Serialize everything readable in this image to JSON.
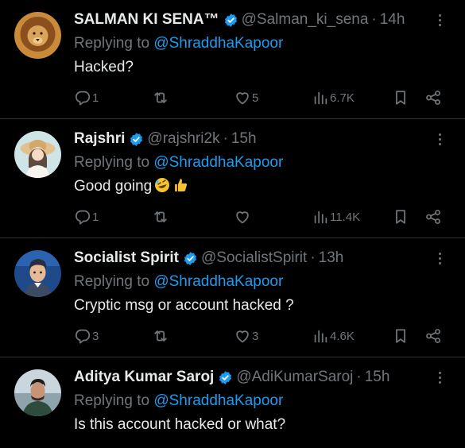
{
  "replies": [
    {
      "name": "SALMAN KI SENA™",
      "handle": "@Salman_ki_sena",
      "dot": "·",
      "time": "14h",
      "replying_prefix": "Replying to ",
      "replying_to": "@ShraddhaKapoor",
      "text": "Hacked?",
      "reply_count": "1",
      "retweet_count": "",
      "like_count": "5",
      "views": "6.7K",
      "avatar_icon": "lion-avatar-icon",
      "emojis": []
    },
    {
      "name": "Rajshri",
      "handle": "@rajshri2k",
      "dot": "·",
      "time": "15h",
      "replying_prefix": "Replying to ",
      "replying_to": "@ShraddhaKapoor",
      "text": "Good going",
      "reply_count": "1",
      "retweet_count": "",
      "like_count": "",
      "views": "11.4K",
      "avatar_icon": "girl-avatar-icon",
      "emojis": [
        "rolling-laughing-emoji",
        "thumbs-up-emoji"
      ]
    },
    {
      "name": "Socialist Spirit",
      "handle": "@SocialistSpirit",
      "dot": "·",
      "time": "13h",
      "replying_prefix": "Replying to ",
      "replying_to": "@ShraddhaKapoor",
      "text": "Cryptic msg or account hacked ?",
      "reply_count": "3",
      "retweet_count": "",
      "like_count": "3",
      "views": "4.6K",
      "avatar_icon": "cartoon-man-avatar-icon",
      "emojis": []
    },
    {
      "name": "Aditya Kumar Saroj",
      "handle": "@AdiKumarSaroj",
      "dot": "·",
      "time": "15h",
      "replying_prefix": "Replying to ",
      "replying_to": "@ShraddhaKapoor",
      "text": "Is this account hacked or what?",
      "avatar_icon": "man-photo-avatar-icon",
      "emojis": []
    }
  ],
  "colors": {
    "background": "#000000",
    "text": "#e7e9ea",
    "muted": "#71767b",
    "accent": "#1d9bf0",
    "divider": "#2f3336"
  }
}
